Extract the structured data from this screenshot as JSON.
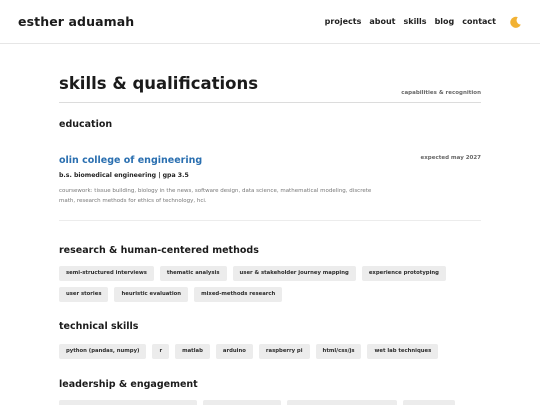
{
  "header": {
    "brand": "esther aduamah",
    "nav": [
      "projects",
      "about",
      "skills",
      "blog",
      "contact"
    ],
    "theme_icon": "moon-icon"
  },
  "page": {
    "title": "skills & qualifications",
    "subtitle": "capabilities & recognition"
  },
  "education": {
    "heading": "education",
    "school": "olin college of engineering",
    "expected": "expected may 2027",
    "degree": "b.s. biomedical engineering | gpa 3.5",
    "coursework": "coursework: tissue building, biology in the news, software design, data science, mathematical modeling, discrete math, research methods for ethics of technology, hci."
  },
  "research": {
    "heading": "research & human-centered methods",
    "tags": [
      "semi-structured interviews",
      "thematic analysis",
      "user & stakeholder journey mapping",
      "experience prototyping",
      "user stories",
      "heuristic evaluation",
      "mixed-methods research"
    ]
  },
  "technical": {
    "heading": "technical skills",
    "tags": [
      "python (pandas, numpy)",
      "r",
      "matlab",
      "arduino",
      "raspberry pi",
      "html/css/js",
      "wet lab techniques"
    ]
  },
  "leadership": {
    "heading": "leadership & engagement"
  },
  "colors": {
    "accent": "#2a6fb0",
    "tag_bg": "#ececec",
    "moon": "#f2b233"
  }
}
